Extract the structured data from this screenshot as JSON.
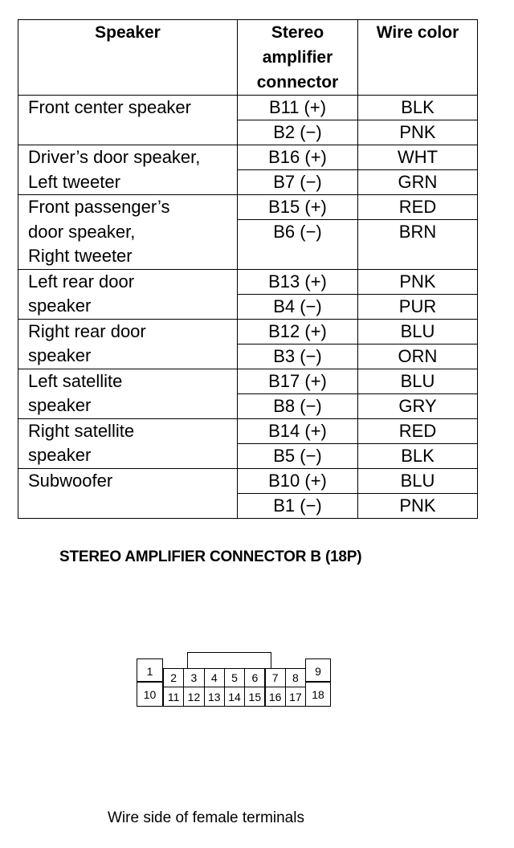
{
  "table": {
    "headers": {
      "speaker": "Speaker",
      "connector": [
        "Stereo",
        "amplifier",
        "connector"
      ],
      "wire_color": "Wire color"
    },
    "rows": [
      {
        "speaker": "Front center speaker",
        "pins": [
          {
            "terminal": "B11 (+)",
            "color": "BLK"
          },
          {
            "terminal": "B2 (−)",
            "color": "PNK"
          }
        ]
      },
      {
        "speaker": "Driver’s door speaker,\nLeft tweeter",
        "pins": [
          {
            "terminal": "B16 (+)",
            "color": "WHT"
          },
          {
            "terminal": "B7 (−)",
            "color": "GRN"
          }
        ]
      },
      {
        "speaker": "Front passenger’s\ndoor speaker,\nRight tweeter",
        "pins": [
          {
            "terminal": "B15 (+)",
            "color": "RED"
          },
          {
            "terminal": "B6 (−)",
            "color": "BRN"
          }
        ]
      },
      {
        "speaker": "Left rear door\nspeaker",
        "pins": [
          {
            "terminal": "B13 (+)",
            "color": "PNK"
          },
          {
            "terminal": "B4 (−)",
            "color": "PUR"
          }
        ]
      },
      {
        "speaker": "Right rear door\nspeaker",
        "pins": [
          {
            "terminal": "B12 (+)",
            "color": "BLU"
          },
          {
            "terminal": "B3 (−)",
            "color": "ORN"
          }
        ]
      },
      {
        "speaker": "Left satellite\nspeaker",
        "pins": [
          {
            "terminal": "B17 (+)",
            "color": "BLU"
          },
          {
            "terminal": "B8 (−)",
            "color": "GRY"
          }
        ]
      },
      {
        "speaker": "Right satellite\nspeaker",
        "pins": [
          {
            "terminal": "B14 (+)",
            "color": "RED"
          },
          {
            "terminal": "B5 (−)",
            "color": "BLK"
          }
        ]
      },
      {
        "speaker": "Subwoofer",
        "pins": [
          {
            "terminal": "B10 (+)",
            "color": "BLU"
          },
          {
            "terminal": "B1 (−)",
            "color": "PNK"
          }
        ]
      }
    ]
  },
  "connector": {
    "title": "STEREO AMPLIFIER CONNECTOR B (18P)",
    "caption": "Wire side of female terminals",
    "top_pins": [
      "1",
      "2",
      "3",
      "4",
      "5",
      "6",
      "7",
      "8",
      "9"
    ],
    "bottom_pins": [
      "10",
      "11",
      "12",
      "13",
      "14",
      "15",
      "16",
      "17",
      "18"
    ]
  }
}
